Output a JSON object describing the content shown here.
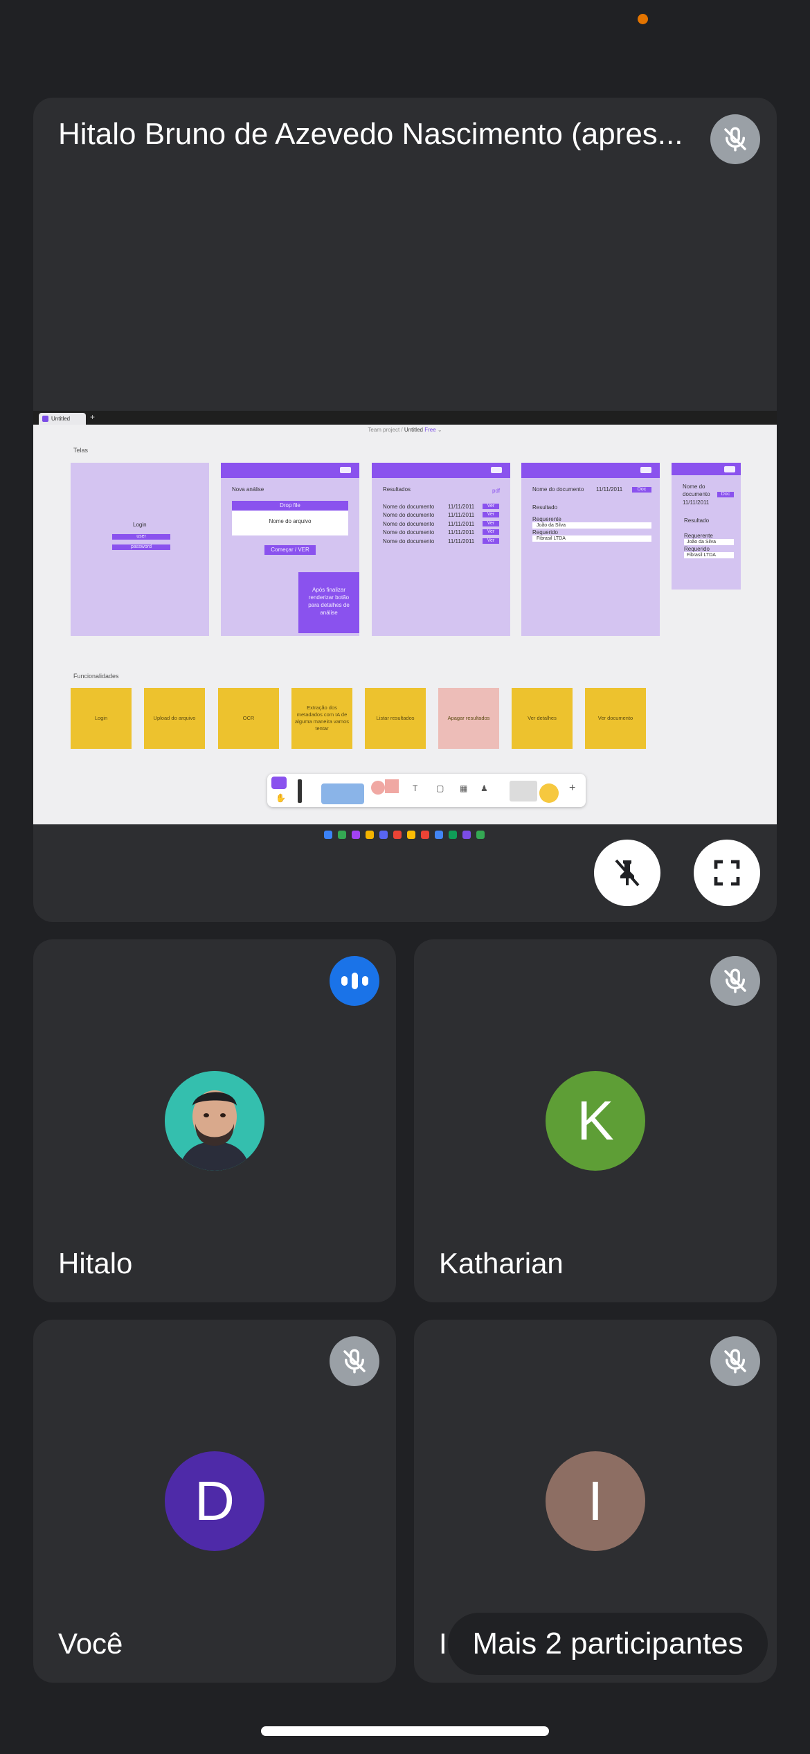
{
  "presenter": {
    "name": "Hitalo Bruno de Azevedo Nascimento (apres...",
    "pin_icon": "pin-off-icon",
    "fullscreen_icon": "fullscreen-icon"
  },
  "shared_screen": {
    "browser_tab": "Untitled",
    "project_path": "Team project",
    "file_name": "Untitled",
    "plan": "Free",
    "section_screens": "Telas",
    "section_features": "Funcionalidades",
    "frame1": {
      "title": "Login",
      "user": "user",
      "password": "password"
    },
    "frame2": {
      "title": "Nova análise",
      "drop": "Drop file",
      "file": "Nome do arquivo",
      "start": "Começar / VER",
      "callout": "Após finalizar renderizar botão para detalhes de análise"
    },
    "frame3": {
      "title": "Resultados",
      "badge": "pdf",
      "rows": [
        {
          "name": "Nome do documento",
          "date": "11/11/2011",
          "action": "Ver"
        },
        {
          "name": "Nome do documento",
          "date": "11/11/2011",
          "action": "Ver"
        },
        {
          "name": "Nome do documento",
          "date": "11/11/2011",
          "action": "Ver"
        },
        {
          "name": "Nome do documento",
          "date": "11/11/2011",
          "action": "Ver"
        },
        {
          "name": "Nome do documento",
          "date": "11/11/2011",
          "action": "Ver"
        }
      ]
    },
    "frame4": {
      "title": "Nome do documento",
      "date": "11/11/2011",
      "button": "Doc",
      "result": "Resultado",
      "req1_label": "Requerente",
      "req1_value": "João da Silva",
      "req2_label": "Requerido",
      "req2_value": "Fibrasil LTDA"
    },
    "frame5": {
      "title_line1": "Nome do",
      "title_line2": "documento",
      "button": "Doc",
      "date": "11/11/2011",
      "result": "Resultado",
      "req1_label": "Requerente",
      "req1_value": "João da Silva",
      "req2_label": "Requerido",
      "req2_value": "Fibrasil LTDA"
    },
    "notes": [
      "Login",
      "Upload do arquivo",
      "OCR",
      "Extração dos metadados com IA de alguma maneira vamos tentar",
      "Listar resultados",
      "Apagar resultados",
      "Ver detalhes",
      "Ver documento"
    ]
  },
  "participants": [
    {
      "name": "Hitalo",
      "status_icon": "speaking-icon",
      "avatar": "photo",
      "color": "#1a73e8"
    },
    {
      "name": "Katharian",
      "initial": "K",
      "status_icon": "mic-off-icon",
      "color": "#5e9e36"
    },
    {
      "name": "Você",
      "initial": "D",
      "status_icon": "mic-off-icon",
      "color": "#4e2aa8"
    },
    {
      "name": "I",
      "initial": "I",
      "status_icon": "mic-off-icon",
      "color": "#8d6e63"
    }
  ],
  "more_participants": "Mais 2 participantes"
}
